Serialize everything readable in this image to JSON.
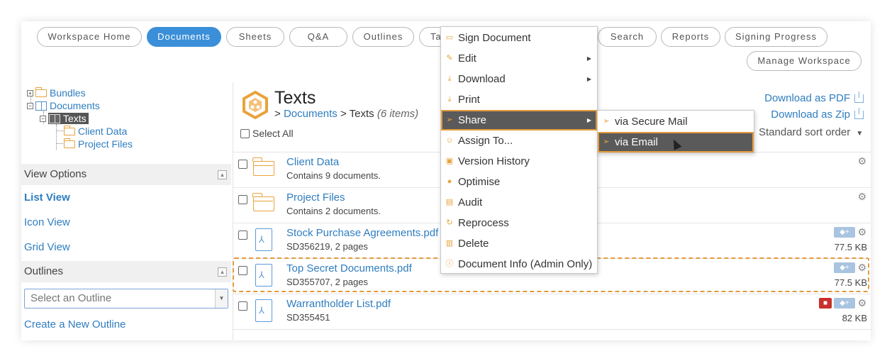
{
  "tabs": [
    {
      "label": "Workspace Home",
      "active": false
    },
    {
      "label": "Documents",
      "active": true
    },
    {
      "label": "Sheets",
      "active": false
    },
    {
      "label": "Q&A",
      "active": false
    },
    {
      "label": "Outlines",
      "active": false
    },
    {
      "label": "Ta",
      "active": false
    },
    {
      "label": "Search",
      "active": false
    },
    {
      "label": "Reports",
      "active": false
    },
    {
      "label": "Signing Progress",
      "active": false
    }
  ],
  "manage_workspace": "Manage Workspace",
  "tree": {
    "bundles": "Bundles",
    "documents": "Documents",
    "texts": "Texts",
    "client_data": "Client Data",
    "project_files": "Project Files"
  },
  "view_options": {
    "heading": "View Options",
    "items": [
      "List View",
      "Icon View",
      "Grid View"
    ],
    "selected": "List View"
  },
  "outlines": {
    "heading": "Outlines",
    "select_placeholder": "Select an Outline",
    "create_link": "Create a New Outline"
  },
  "header": {
    "title": "Texts",
    "crumb_sep": ">",
    "crumb_parent": "Documents",
    "crumb_current": "Texts",
    "count": "(6 items)",
    "select_all": "Select All",
    "download_pdf": "Download as PDF",
    "download_zip": "Download as Zip",
    "sort": "Standard sort order"
  },
  "rows": [
    {
      "name": "Client Data",
      "sub": "Contains 9 documents.",
      "type": "folder",
      "size": ""
    },
    {
      "name": "Project Files",
      "sub": "Contains 2 documents.",
      "type": "folder",
      "size": ""
    },
    {
      "name": "Stock Purchase Agreements.pdf",
      "sub": "SD356219, 2 pages",
      "type": "pdf",
      "size": "77.5 KB"
    },
    {
      "name": "Top Secret Documents.pdf",
      "sub": "SD355707, 2 pages",
      "type": "pdf",
      "size": "77.5 KB"
    },
    {
      "name": "Warrantholder List.pdf",
      "sub": "SD355451",
      "type": "pdf",
      "size": "82 KB"
    }
  ],
  "context_menu": {
    "items": [
      {
        "label": "Sign Document",
        "icon": "folder-open-icon",
        "submenu": false
      },
      {
        "label": "Edit",
        "icon": "pencil-icon",
        "submenu": true
      },
      {
        "label": "Download",
        "icon": "download-icon",
        "submenu": true
      },
      {
        "label": "Print",
        "icon": "print-icon",
        "submenu": false
      },
      {
        "label": "Share",
        "icon": "send-icon",
        "submenu": true,
        "active": true
      },
      {
        "label": "Assign To...",
        "icon": "people-icon",
        "submenu": false
      },
      {
        "label": "Version History",
        "icon": "history-icon",
        "submenu": false
      },
      {
        "label": "Optimise",
        "icon": "bulb-icon",
        "submenu": false
      },
      {
        "label": "Audit",
        "icon": "audit-icon",
        "submenu": false
      },
      {
        "label": "Reprocess",
        "icon": "refresh-icon",
        "submenu": false
      },
      {
        "label": "Delete",
        "icon": "trash-icon",
        "submenu": false
      },
      {
        "label": "Document Info (Admin Only)",
        "icon": "info-icon",
        "submenu": false
      }
    ],
    "share_submenu": [
      {
        "label": "via Secure Mail",
        "active": false
      },
      {
        "label": "via Email",
        "active": true
      }
    ]
  },
  "colors": {
    "accent_blue": "#3b8fd8",
    "link_blue": "#2f7dc0",
    "highlight_orange": "#e39a3b",
    "menu_active_bg": "#5a5a5a",
    "lock_red": "#c9302c",
    "tag_blue": "#a9c4e0"
  }
}
